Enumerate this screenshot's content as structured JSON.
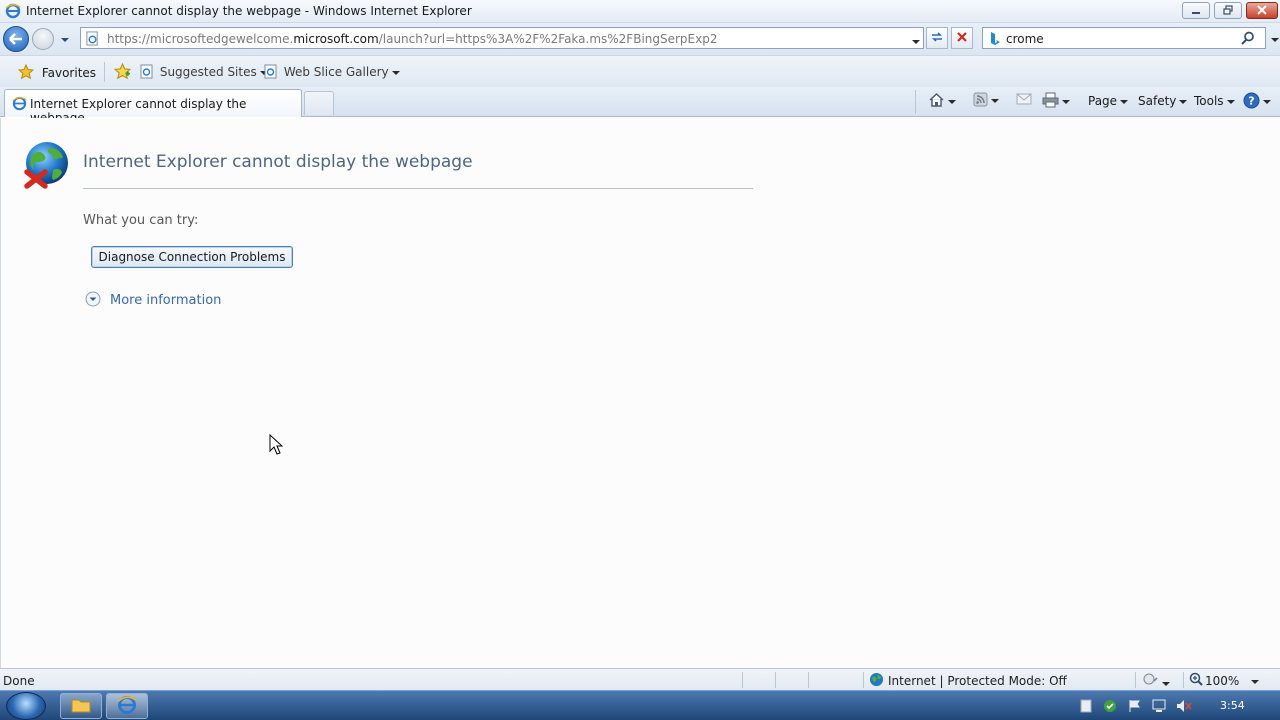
{
  "window": {
    "title": "Internet Explorer cannot display the webpage - Windows Internet Explorer"
  },
  "address_bar": {
    "url_prefix": "https://microsoftedgewelcome.",
    "url_domain": "microsoft.com",
    "url_suffix": "/launch?url=https%3A%2F%2Faka.ms%2FBingSerpExp2"
  },
  "search": {
    "query": "crome"
  },
  "favorites_bar": {
    "favorites_label": "Favorites",
    "suggested_sites_label": "Suggested Sites",
    "web_slice_label": "Web Slice Gallery"
  },
  "tabs": [
    {
      "label": "Internet Explorer cannot display the webpage"
    }
  ],
  "command_bar": {
    "page_label": "Page",
    "safety_label": "Safety",
    "tools_label": "Tools"
  },
  "error_page": {
    "title": "Internet Explorer cannot display the webpage",
    "try_label": "What you can try:",
    "diagnose_button": "Diagnose Connection Problems",
    "more_info": "More information"
  },
  "status_bar": {
    "status": "Done",
    "zone": "Internet | Protected Mode: Off",
    "zoom": "100%"
  },
  "taskbar": {
    "clock": "3:54"
  },
  "colors": {
    "accent": "#1f5fb6",
    "error_title": "#4e6680",
    "link": "#3a6aa5",
    "error_red": "#d42a1e"
  },
  "icons": [
    "ie-icon",
    "minimize-icon",
    "restore-icon",
    "close-icon",
    "back-icon",
    "forward-icon",
    "refresh-icon",
    "stop-icon",
    "bing-icon",
    "search-icon",
    "favorites-star-icon",
    "add-favorites-icon",
    "home-icon",
    "feeds-icon",
    "mail-icon",
    "print-icon",
    "help-icon",
    "globe-error-icon",
    "expand-icon",
    "cursor-icon",
    "start-orb-icon",
    "explorer-icon"
  ]
}
